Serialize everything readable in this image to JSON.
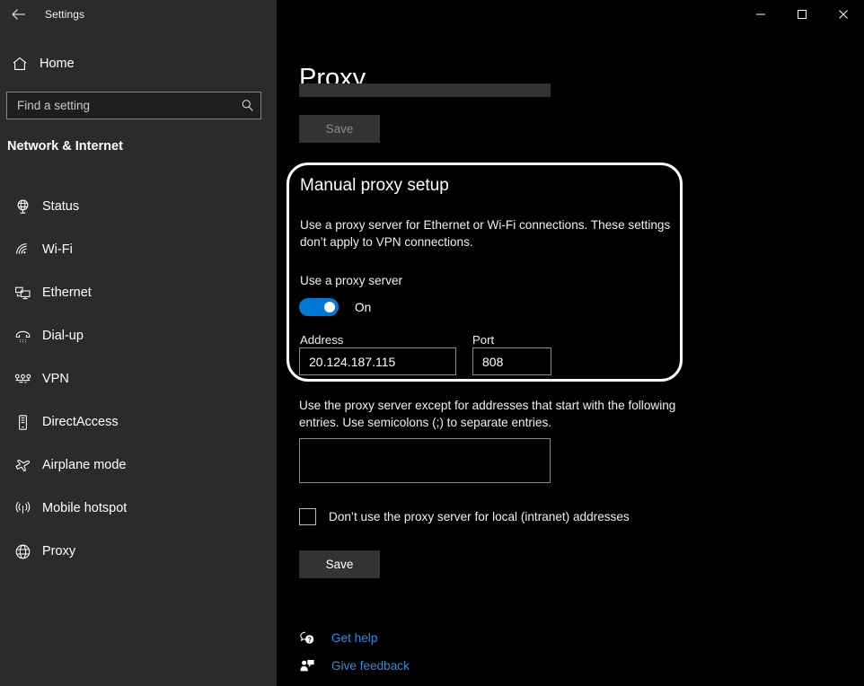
{
  "window": {
    "app_title": "Settings",
    "back_icon": "back-arrow-icon",
    "minimize_label": "Minimize",
    "maximize_label": "Maximize",
    "close_label": "Close"
  },
  "sidebar": {
    "home": {
      "label": "Home",
      "icon": "home-icon"
    },
    "search": {
      "placeholder": "Find a setting",
      "value": "",
      "icon": "search-icon"
    },
    "category": "Network & Internet",
    "items": [
      {
        "label": "Status",
        "icon": "status-globe-icon"
      },
      {
        "label": "Wi-Fi",
        "icon": "wifi-icon"
      },
      {
        "label": "Ethernet",
        "icon": "ethernet-icon"
      },
      {
        "label": "Dial-up",
        "icon": "dialup-phone-icon"
      },
      {
        "label": "VPN",
        "icon": "vpn-icon"
      },
      {
        "label": "DirectAccess",
        "icon": "directaccess-icon"
      },
      {
        "label": "Airplane mode",
        "icon": "airplane-icon"
      },
      {
        "label": "Mobile hotspot",
        "icon": "hotspot-icon"
      },
      {
        "label": "Proxy",
        "icon": "proxy-globe-icon"
      }
    ]
  },
  "main": {
    "page_title": "Proxy",
    "top_save_label": "Save",
    "manual_section": {
      "title": "Manual proxy setup",
      "description": "Use a proxy server for Ethernet or Wi-Fi connections. These settings don’t apply to VPN connections.",
      "toggle_label": "Use a proxy server",
      "toggle_state": "On",
      "address_label": "Address",
      "address_value": "20.124.187.115",
      "address_placeholder": "",
      "port_label": "Port",
      "port_value": "808",
      "port_placeholder": ""
    },
    "exceptions": {
      "description": "Use the proxy server except for addresses that start with the following entries. Use semicolons (;) to separate entries.",
      "value": "",
      "placeholder": ""
    },
    "local_checkbox_label": "Don’t use the proxy server for local (intranet) addresses",
    "local_checkbox_checked": false,
    "bottom_save_label": "Save",
    "links": [
      {
        "label": "Get help",
        "icon": "help-bubble-icon"
      },
      {
        "label": "Give feedback",
        "icon": "feedback-person-icon"
      }
    ]
  },
  "colors": {
    "sidebar_bg": "#2b2b2b",
    "content_bg": "#000000",
    "accent": "#0078d7",
    "link": "#2f8ee0",
    "button_bg": "#333333",
    "highlight_ring": "#ffffff"
  }
}
